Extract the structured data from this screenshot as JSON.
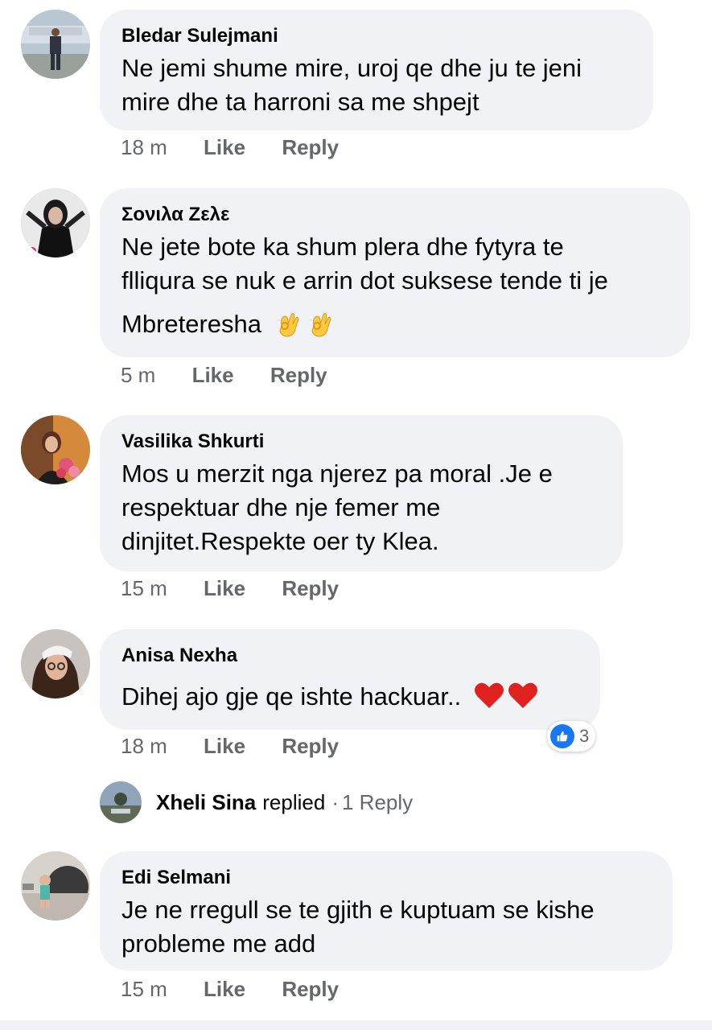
{
  "comments": [
    {
      "author": "Bledar Sulejmani",
      "text_lines": [
        "Ne jemi shume mire, uroj qe dhe ju te jeni",
        "mire dhe ta harroni sa me shpejt"
      ],
      "time": "18 m",
      "like_label": "Like",
      "reply_label": "Reply"
    },
    {
      "author": "Σονιλα Ζελε",
      "text_lines": [
        "Ne jete bote ka shum plera dhe fytyra te",
        "flliqura se nuk e arrin dot suksese tende ti je",
        "Mbreteresha"
      ],
      "emojis": [
        "ok-hand-icon",
        "ok-hand-icon"
      ],
      "time": "5 m",
      "like_label": "Like",
      "reply_label": "Reply"
    },
    {
      "author": "Vasilika Shkurti",
      "text_lines": [
        "Mos u merzit nga njerez pa moral .Je e",
        "respektuar dhe nje femer me",
        "dinjitet.Respekte oer ty Klea."
      ],
      "time": "15 m",
      "like_label": "Like",
      "reply_label": "Reply"
    },
    {
      "author": "Anisa Nexha",
      "text_lines": [
        "Dihej ajo gje qe ishte hackuar.."
      ],
      "emojis": [
        "red-heart-icon",
        "red-heart-icon"
      ],
      "time": "18 m",
      "like_label": "Like",
      "reply_label": "Reply",
      "reactions": {
        "icon": "thumbs-up-icon",
        "count": "3"
      },
      "replies": {
        "name": "Xheli Sina",
        "action": "replied",
        "separator": "·",
        "count_label": "1 Reply"
      }
    },
    {
      "author": "Edi Selmani",
      "text_lines": [
        "Je ne rregull se te gjith e kuptuam se kishe",
        "probleme me add"
      ],
      "time": "15 m",
      "like_label": "Like",
      "reply_label": "Reply"
    }
  ],
  "colors": {
    "bubble": "#f0f2f5",
    "meta_text": "#65676b",
    "like_blue": "#1877f2"
  }
}
